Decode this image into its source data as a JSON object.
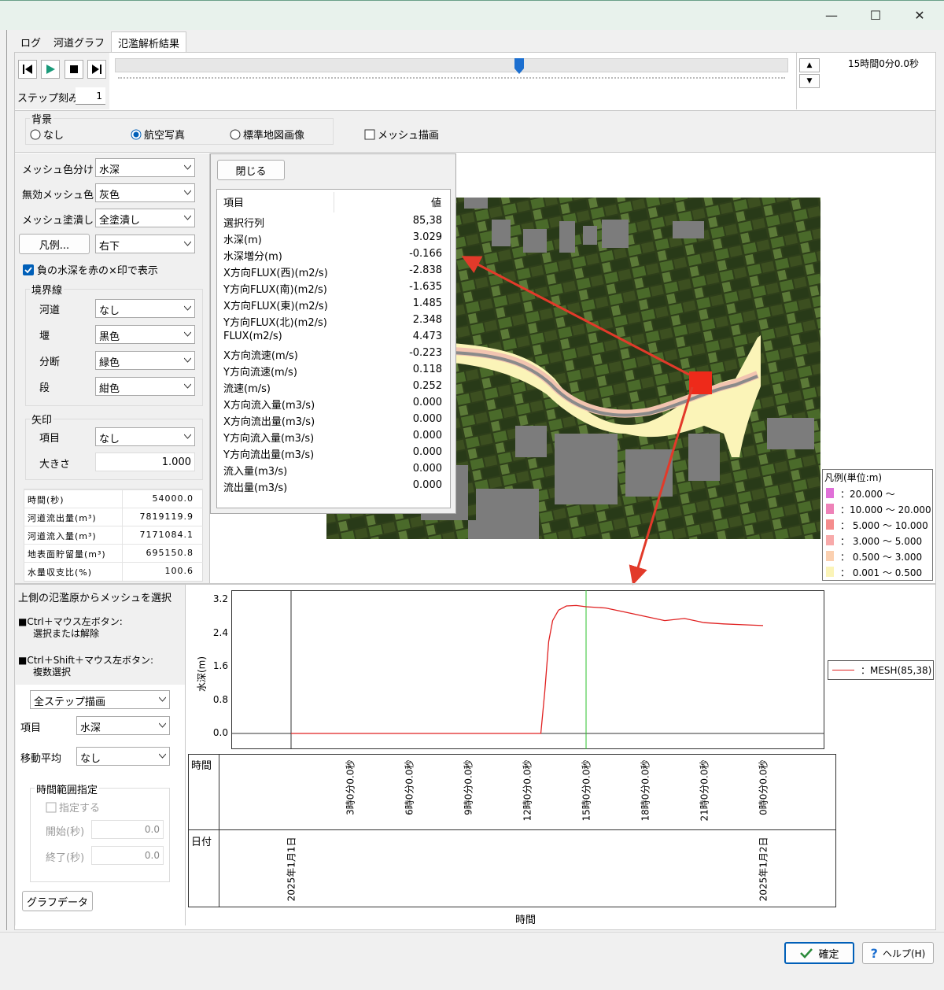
{
  "window": {
    "minimize": "—",
    "maximize": "☐",
    "close": "✕"
  },
  "tabs": [
    "ログ",
    "河道グラフ",
    "氾濫解析結果"
  ],
  "playback": {
    "step_label": "ステップ刻み",
    "step_value": "1",
    "time_display": "15時間0分0.0秒",
    "slider_position": 0.6
  },
  "background": {
    "title": "背景",
    "options": [
      "なし",
      "航空写真",
      "標準地図画像"
    ],
    "selected": "航空写真",
    "mesh_draw_label": "メッシュ描画"
  },
  "settings": {
    "mesh_color_label": "メッシュ色分け",
    "mesh_color_value": "水深",
    "invalid_mesh_label": "無効メッシュ色",
    "invalid_mesh_value": "灰色",
    "mesh_fill_label": "メッシュ塗潰し",
    "mesh_fill_value": "全塗潰し",
    "legend_button": "凡例...",
    "legend_pos_value": "右下",
    "negative_depth_label": "負の水深を赤の×印で表示"
  },
  "boundary": {
    "title": "境界線",
    "rows": [
      {
        "label": "河道",
        "value": "なし"
      },
      {
        "label": "堰",
        "value": "黒色"
      },
      {
        "label": "分断",
        "value": "緑色"
      },
      {
        "label": "段",
        "value": "紺色"
      }
    ]
  },
  "arrow": {
    "title": "矢印",
    "item_label": "項目",
    "item_value": "なし",
    "size_label": "大きさ",
    "size_value": "1.000"
  },
  "stats": [
    {
      "label": "時間(秒)",
      "value": "54000.0"
    },
    {
      "label": "河道流出量(m³)",
      "value": "7819119.9"
    },
    {
      "label": "河道流入量(m³)",
      "value": "7171084.1"
    },
    {
      "label": "地表面貯留量(m³)",
      "value": "695150.8"
    },
    {
      "label": "水量収支比(%)",
      "value": "100.6"
    }
  ],
  "info_panel": {
    "close_button": "閉じる",
    "col_item": "項目",
    "col_value": "値",
    "rows": [
      {
        "k": "選択行列",
        "v": "85,38"
      },
      {
        "k": "水深(m)",
        "v": "3.029"
      },
      {
        "k": "水深増分(m)",
        "v": "-0.166"
      },
      {
        "k": "X方向FLUX(西)(m2/s)",
        "v": "-2.838"
      },
      {
        "k": "Y方向FLUX(南)(m2/s)",
        "v": "-1.635"
      },
      {
        "k": "X方向FLUX(東)(m2/s)",
        "v": "1.485"
      },
      {
        "k": "Y方向FLUX(北)(m2/s)",
        "v": "2.348"
      },
      {
        "k": "FLUX(m2/s)",
        "v": "4.473"
      },
      {
        "k": "X方向流速(m/s)",
        "v": "-0.223"
      },
      {
        "k": "Y方向流速(m/s)",
        "v": "0.118"
      },
      {
        "k": "流速(m/s)",
        "v": "0.252"
      },
      {
        "k": "X方向流入量(m3/s)",
        "v": "0.000"
      },
      {
        "k": "X方向流出量(m3/s)",
        "v": "0.000"
      },
      {
        "k": "Y方向流入量(m3/s)",
        "v": "0.000"
      },
      {
        "k": "Y方向流出量(m3/s)",
        "v": "0.000"
      },
      {
        "k": "流入量(m3/s)",
        "v": "0.000"
      },
      {
        "k": "流出量(m3/s)",
        "v": "0.000"
      }
    ]
  },
  "map_legend": {
    "title": "凡例(単位:m)",
    "rows": [
      {
        "color": "#e070d8",
        "text": "：20.000 〜"
      },
      {
        "color": "#ee82b8",
        "text": "：10.000 〜 20.000"
      },
      {
        "color": "#f58c8c",
        "text": "：  5.000 〜 10.000"
      },
      {
        "color": "#f8aaaa",
        "text": "：  3.000 〜   5.000"
      },
      {
        "color": "#fbd0b0",
        "text": "：  0.500 〜   3.000"
      },
      {
        "color": "#fbf4b8",
        "text": "：  0.001 〜   0.500"
      }
    ]
  },
  "graph_controls": {
    "hint_title": "上側の氾濫原からメッシュを選択",
    "hint1_a": "■Ctrl＋マウス左ボタン:",
    "hint1_b": "選択または解除",
    "hint2_a": "■Ctrl＋Shift＋マウス左ボタン:",
    "hint2_b": "複数選択",
    "draw_mode": "全ステップ描画",
    "item_label": "項目",
    "item_value": "水深",
    "avg_label": "移動平均",
    "avg_value": "なし",
    "range_title": "時間範囲指定",
    "range_check": "指定する",
    "start_label": "開始(秒)",
    "start_value": "0.0",
    "end_label": "終了(秒)",
    "end_value": "0.0",
    "graph_data_button": "グラフデータ"
  },
  "footer": {
    "ok": "確定",
    "help": "ヘルプ(H)"
  },
  "chart_data": {
    "type": "line",
    "ylabel": "水深(m)",
    "xlabel": "時間",
    "ylim": [
      0,
      3.2
    ],
    "yticks": [
      "3.2",
      "2.4",
      "1.6",
      "0.8",
      "0.0"
    ],
    "xlim_hours": [
      0,
      24
    ],
    "time_row_label": "時間",
    "date_row_label": "日付",
    "time_ticks": [
      "3時0分0.0秒",
      "6時0分0.0秒",
      "9時0分0.0秒",
      "12時0分0.0秒",
      "15時0分0.0秒",
      "18時0分0.0秒",
      "21時0分0.0秒",
      "0時0分0.0秒"
    ],
    "date_ticks": [
      "2025年1月1日",
      "2025年1月2日"
    ],
    "current_time_hours": 15,
    "series": [
      {
        "name": "：MESH(85,38)",
        "color": "#e02020",
        "x": [
          0,
          12.7,
          12.9,
          13.1,
          13.3,
          13.6,
          14.0,
          14.5,
          15.0,
          16.0,
          17.0,
          18.0,
          19.0,
          20.0,
          21.0,
          22.0,
          23.0,
          24.0
        ],
        "y": [
          0,
          0,
          1.0,
          2.2,
          2.7,
          2.95,
          3.05,
          3.06,
          3.03,
          3.0,
          2.9,
          2.8,
          2.7,
          2.75,
          2.65,
          2.62,
          2.6,
          2.58
        ]
      }
    ]
  }
}
